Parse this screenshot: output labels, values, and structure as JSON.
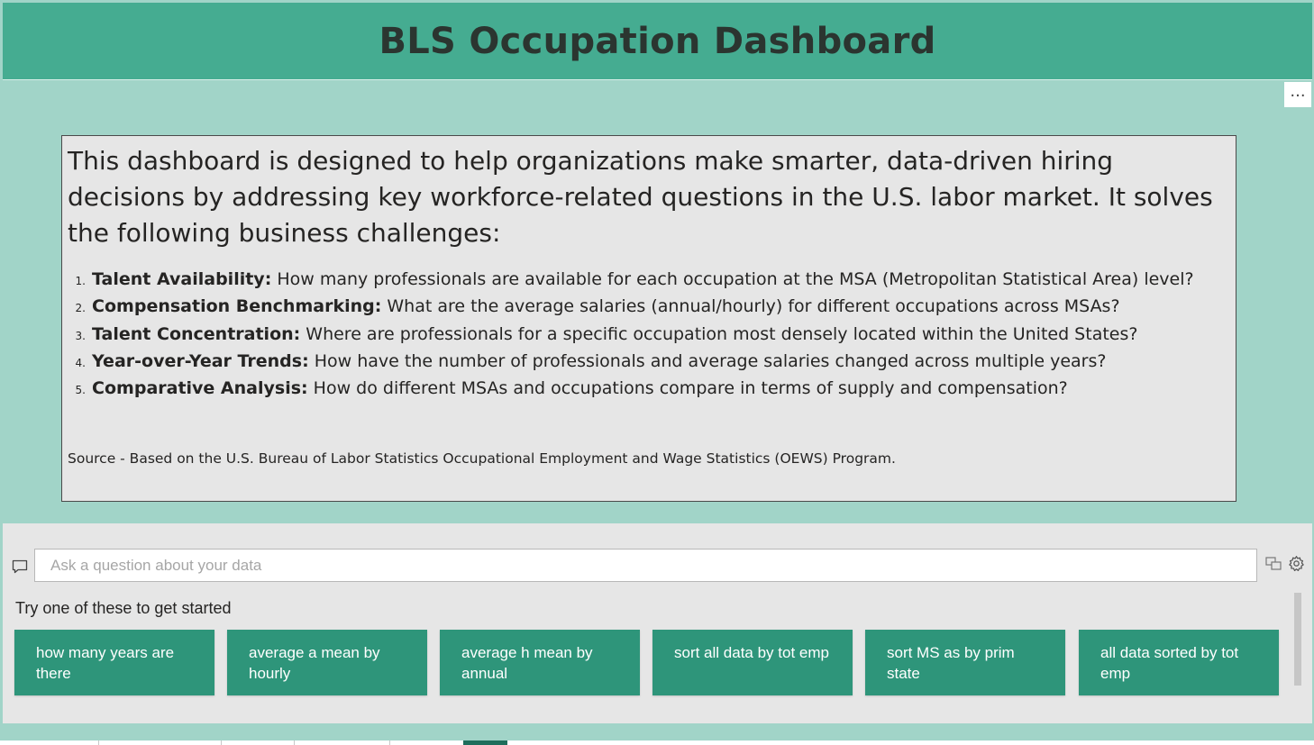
{
  "header": {
    "title": "BLS Occupation Dashboard",
    "more_options_glyph": "..."
  },
  "info_card": {
    "intro": "This dashboard is designed to help organizations make smarter, data-driven hiring decisions by addressing key workforce-related questions in the U.S. labor market. It solves the following business challenges:",
    "items": [
      {
        "number": "1.",
        "term": "Talent Availability:",
        "text": " How many professionals are available for each occupation at the MSA (Metropolitan Statistical Area) level?"
      },
      {
        "number": "2.",
        "term": "Compensation Benchmarking:",
        "text": " What are the average salaries (annual/hourly) for different occupations across MSAs?"
      },
      {
        "number": "3.",
        "term": "Talent Concentration:",
        "text": " Where are professionals for a specific occupation most densely located within the United States?"
      },
      {
        "number": "4.",
        "term": "Year-over-Year Trends:",
        "text": " How have the number of professionals and average salaries changed across multiple years?"
      },
      {
        "number": "5.",
        "term": "Comparative Analysis:",
        "text": " How do different MSAs and occupations compare in terms of supply and compensation?"
      }
    ],
    "source": "Source - Based on the U.S. Bureau of Labor Statistics Occupational Employment and Wage Statistics (OEWS) Program."
  },
  "qa": {
    "placeholder": "Ask a question about your data",
    "value": "",
    "suggest_label": "Try one of these to get started",
    "suggestions": [
      {
        "label": "how many years are there"
      },
      {
        "label": "average a mean by hourly"
      },
      {
        "label": "average h mean by annual"
      },
      {
        "label": "sort all data by tot emp"
      },
      {
        "label": "sort MS as by prim state"
      },
      {
        "label": "all data sorted by tot emp"
      }
    ]
  },
  "icons": {
    "chat": "chat-bubble-icon",
    "view": "view-switch-icon",
    "settings": "gear-icon"
  },
  "colors": {
    "header_bg": "#45ac91",
    "canvas_bg": "#a1d4c8",
    "card_bg": "#e6e6e6",
    "button_bg": "#2e957a",
    "active_tab": "#1f6e5c"
  }
}
